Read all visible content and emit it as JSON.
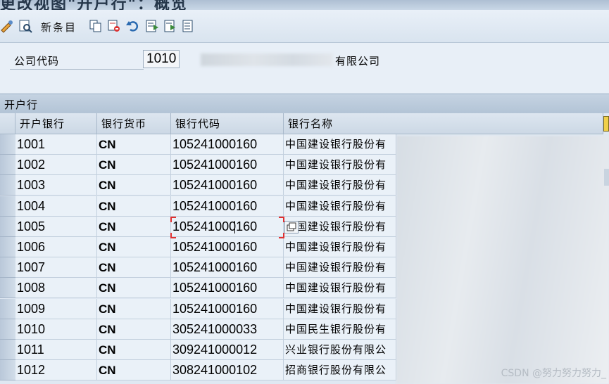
{
  "title": {
    "text": "更改视图\"开户行\"：概览"
  },
  "toolbar": {
    "new_entries_label": "新条目",
    "icons": [
      "change-display-icon",
      "details-icon",
      "copy-icon",
      "delete-icon",
      "undo-icon",
      "select-all-icon",
      "select-block-icon",
      "deselect-all-icon"
    ]
  },
  "header": {
    "company_code_label": "公司代码",
    "company_code_value": "1010",
    "company_name_suffix": "有限公司"
  },
  "section": {
    "title": "开户行"
  },
  "table": {
    "columns": [
      "开户银行",
      "银行货币",
      "银行代码",
      "银行名称"
    ],
    "rows": [
      {
        "bank": "1001",
        "currency": "CN",
        "code": "105241000160",
        "name": "中国建设银行股份有"
      },
      {
        "bank": "1002",
        "currency": "CN",
        "code": "105241000160",
        "name": "中国建设银行股份有"
      },
      {
        "bank": "1003",
        "currency": "CN",
        "code": "105241000160",
        "name": "中国建设银行股份有"
      },
      {
        "bank": "1004",
        "currency": "CN",
        "code": "105241000160",
        "name": "中国建设银行股份有"
      },
      {
        "bank": "1005",
        "currency": "CN",
        "code": "105241000160",
        "name": "中国建设银行股份有"
      },
      {
        "bank": "1006",
        "currency": "CN",
        "code": "105241000160",
        "name": "中国建设银行股份有"
      },
      {
        "bank": "1007",
        "currency": "CN",
        "code": "105241000160",
        "name": "中国建设银行股份有"
      },
      {
        "bank": "1008",
        "currency": "CN",
        "code": "105241000160",
        "name": "中国建设银行股份有"
      },
      {
        "bank": "1009",
        "currency": "CN",
        "code": "105241000160",
        "name": "中国建设银行股份有"
      },
      {
        "bank": "1010",
        "currency": "CN",
        "code": "305241000033",
        "name": "中国民生银行股份有"
      },
      {
        "bank": "1011",
        "currency": "CN",
        "code": "309241000012",
        "name": "兴业银行股份有限公"
      },
      {
        "bank": "1012",
        "currency": "CN",
        "code": "308241000102",
        "name": "招商银行股份有限公"
      }
    ]
  },
  "watermark": "CSDN @努力努力努力_",
  "colors": {
    "background": "#e4edf6",
    "focus": "#e03030",
    "header": "#ccd8e5"
  }
}
